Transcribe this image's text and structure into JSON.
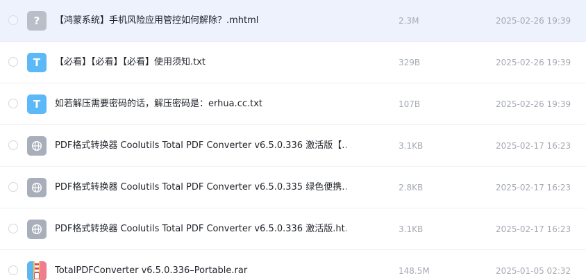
{
  "files": [
    {
      "name": "【鸿蒙系统】手机风险应用管控如何解除？.mhtml",
      "size": "2.3M",
      "date": "2025-02-26 19:39",
      "icon": "question-file-icon",
      "icon_glyph": "?",
      "selected": true
    },
    {
      "name": "【必看】【必看】【必看】使用须知.txt",
      "size": "329B",
      "date": "2025-02-26 19:39",
      "icon": "text-file-icon",
      "icon_glyph": "T",
      "selected": false
    },
    {
      "name": "如若解压需要密码的话，解压密码是：erhua.cc.txt",
      "size": "107B",
      "date": "2025-02-26 19:39",
      "icon": "text-file-icon",
      "icon_glyph": "T",
      "selected": false
    },
    {
      "name": "PDF格式转换器 Coolutils Total PDF Converter v6.5.0.336 激活版【…",
      "size": "3.1KB",
      "date": "2025-02-17 16:23",
      "icon": "web-file-icon",
      "icon_glyph": "",
      "selected": false
    },
    {
      "name": "PDF格式转换器 Coolutils Total PDF Converter v6.5.0.335 绿色便携…",
      "size": "2.8KB",
      "date": "2025-02-17 16:23",
      "icon": "web-file-icon",
      "icon_glyph": "",
      "selected": false
    },
    {
      "name": "PDF格式转换器 Coolutils Total PDF Converter v6.5.0.336 激活版.ht…",
      "size": "3.1KB",
      "date": "2025-02-17 16:23",
      "icon": "web-file-icon",
      "icon_glyph": "",
      "selected": false
    },
    {
      "name": "TotalPDFConverter v6.5.0.336–Portable.rar",
      "size": "148.5M",
      "date": "2025-01-05 02:32",
      "icon": "archive-file-icon",
      "icon_glyph": "",
      "selected": false
    }
  ],
  "colors": {
    "selected_row": "#eef2fd",
    "text_icon": "#5cb9f7",
    "meta_text": "#a4a9b3"
  }
}
